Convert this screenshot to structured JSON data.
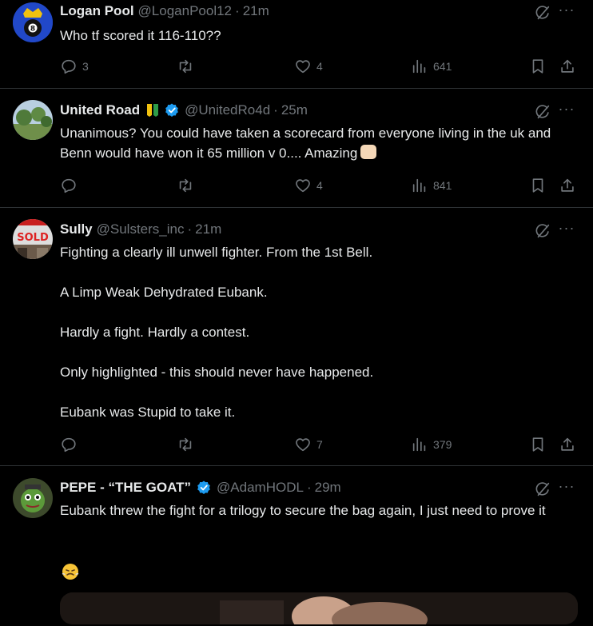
{
  "tweets": [
    {
      "name": "Logan Pool",
      "handle": "@LoganPool12",
      "time": "21m",
      "text": [
        "Who tf scored it 116-110??"
      ],
      "replies": "3",
      "retweets": "",
      "likes": "4",
      "views": "641"
    },
    {
      "name": "United Road",
      "handle": "@UnitedRo4d",
      "time": "25m",
      "text": [
        "Unanimous? You could have taken a scorecard from everyone living in the uk and Benn would have won it 65 million v 0.... Amazing"
      ],
      "replies": "",
      "retweets": "",
      "likes": "4",
      "views": "841"
    },
    {
      "name": "Sully",
      "handle": "@Sulsters_inc",
      "time": "21m",
      "text": [
        "Fighting a clearly ill unwell fighter. From the 1st Bell.",
        "A Limp Weak Dehydrated Eubank.",
        "Hardly a fight. Hardly a contest.",
        "Only highlighted - this should never have happened.",
        "Eubank was Stupid to take it."
      ],
      "replies": "",
      "retweets": "",
      "likes": "7",
      "views": "379"
    },
    {
      "name": "PEPE - “THE GOAT”",
      "handle": "@AdamHODL",
      "time": "29m",
      "text": [
        "Eubank threw the fight for a trilogy to secure the bag again, I just need to prove it"
      ],
      "replies": "",
      "retweets": "",
      "likes": "",
      "views": ""
    }
  ],
  "colors": {
    "background": "#000000",
    "text": "#e7e9ea",
    "muted": "#71767b",
    "verified": "#1d9bf0",
    "divider": "#2f3336"
  },
  "icons": [
    "reply-icon",
    "retweet-icon",
    "like-icon",
    "views-icon",
    "bookmark-icon",
    "share-icon",
    "grok-icon",
    "more-icon",
    "verified-icon"
  ]
}
